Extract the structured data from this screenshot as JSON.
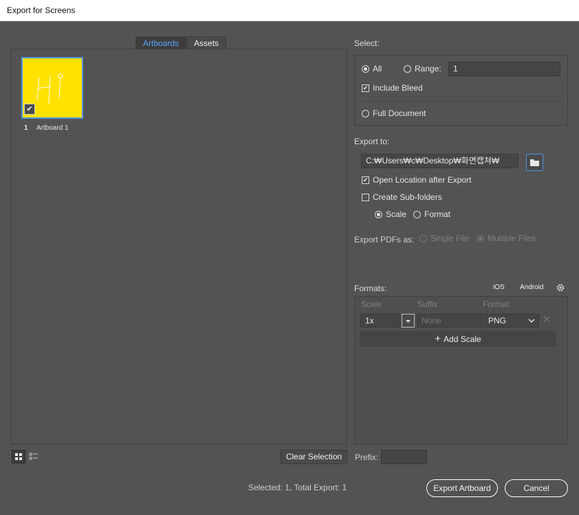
{
  "window": {
    "title": "Export for Screens"
  },
  "tabs": [
    {
      "label": "Artboards",
      "active": true
    },
    {
      "label": "Assets",
      "active": false
    }
  ],
  "artboards": [
    {
      "number": "1",
      "name": "Artboard 1",
      "checked": true,
      "thumbnail_color": "#ffe200",
      "thumbnail_text": "Hi"
    }
  ],
  "left_footer": {
    "clear_selection": "Clear Selection"
  },
  "select": {
    "header": "Select:",
    "all_label": "All",
    "range_label": "Range:",
    "range_value": "1",
    "include_bleed_label": "Include Bleed",
    "full_document_label": "Full Document"
  },
  "export_to": {
    "header": "Export to:",
    "path": "C:₩Users₩c₩Desktop₩화면캡쳐₩",
    "open_location_label": "Open Location after Export",
    "create_subfolders_label": "Create Sub-folders",
    "scale_label": "Scale",
    "format_label": "Format"
  },
  "export_pdfs": {
    "label": "Export PDFs as:",
    "single_file": "Single File",
    "multiple_files": "Multiple Files"
  },
  "formats": {
    "header": "Formats:",
    "ios": "iOS",
    "android": "Android",
    "col_scale": "Scale",
    "col_suffix": "Suffix",
    "col_format": "Format",
    "scale_value": "1x",
    "suffix_placeholder": "None",
    "format_value": "PNG",
    "add_scale": "Add Scale"
  },
  "prefix": {
    "label": "Prefix:",
    "value": ""
  },
  "status": {
    "text": "Selected: 1, Total Export: 1"
  },
  "buttons": {
    "export": "Export Artboard",
    "cancel": "Cancel"
  },
  "colors": {
    "accent": "#4d94e3",
    "tab_active_text": "#5ea4ff",
    "background": "#535353"
  }
}
